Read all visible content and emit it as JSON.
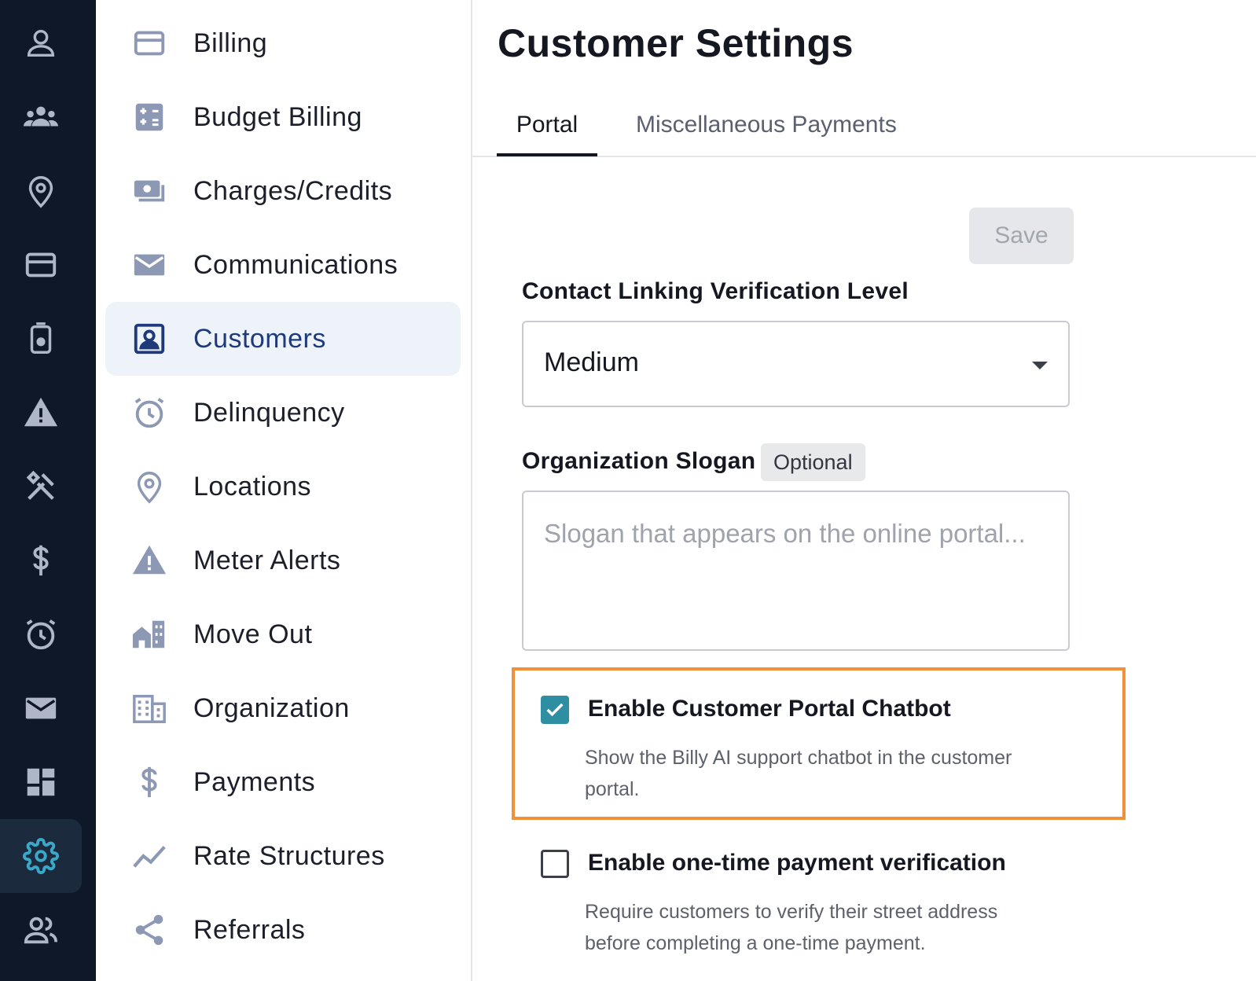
{
  "rail": {
    "items": [
      {
        "name": "account-icon"
      },
      {
        "name": "group-icon"
      },
      {
        "name": "location-icon"
      },
      {
        "name": "credit-card-icon"
      },
      {
        "name": "meter-icon"
      },
      {
        "name": "warning-icon"
      },
      {
        "name": "tools-icon"
      },
      {
        "name": "dollar-icon"
      },
      {
        "name": "alarm-icon"
      },
      {
        "name": "mail-icon"
      },
      {
        "name": "dashboard-icon"
      },
      {
        "name": "settings-icon",
        "active": true
      },
      {
        "name": "users-icon"
      }
    ]
  },
  "subnav": {
    "items": [
      {
        "label": "Billing",
        "icon": "credit-card-icon"
      },
      {
        "label": "Budget Billing",
        "icon": "calculator-icon"
      },
      {
        "label": "Charges/Credits",
        "icon": "money-icon"
      },
      {
        "label": "Communications",
        "icon": "mail-icon"
      },
      {
        "label": "Customers",
        "icon": "contact-card-icon",
        "active": true
      },
      {
        "label": "Delinquency",
        "icon": "alarm-icon"
      },
      {
        "label": "Locations",
        "icon": "location-icon"
      },
      {
        "label": "Meter Alerts",
        "icon": "warning-icon"
      },
      {
        "label": "Move Out",
        "icon": "buildings-icon"
      },
      {
        "label": "Organization",
        "icon": "building-icon"
      },
      {
        "label": "Payments",
        "icon": "dollar-icon"
      },
      {
        "label": "Rate Structures",
        "icon": "trend-icon"
      },
      {
        "label": "Referrals",
        "icon": "share-icon"
      }
    ]
  },
  "main": {
    "title": "Customer Settings",
    "tabs": [
      {
        "label": "Portal",
        "active": true
      },
      {
        "label": "Miscellaneous Payments"
      }
    ],
    "save_label": "Save",
    "contact_linking": {
      "label": "Contact Linking Verification Level",
      "value": "Medium"
    },
    "slogan": {
      "label": "Organization Slogan",
      "badge": "Optional",
      "placeholder": "Slogan that appears on the online portal..."
    },
    "options": [
      {
        "title": "Enable Customer Portal Chatbot",
        "description": "Show the Billy AI support chatbot in the customer portal.",
        "checked": true
      },
      {
        "title": "Enable one-time payment verification",
        "description": "Require customers to verify their street address before completing a one-time payment.",
        "checked": false
      }
    ],
    "highlight_color": "#f0913a",
    "accent_color": "#2e8fa3"
  }
}
